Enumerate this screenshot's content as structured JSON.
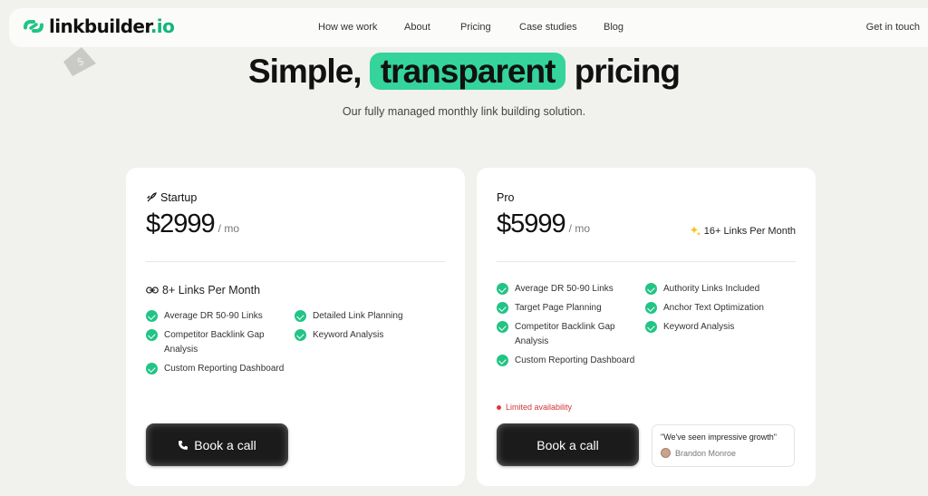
{
  "nav": {
    "brand_main": "linkbuilder",
    "brand_tld": ".io",
    "items": [
      {
        "label": "How we work"
      },
      {
        "label": "About"
      },
      {
        "label": "Pricing"
      },
      {
        "label": "Case studies"
      },
      {
        "label": "Blog"
      }
    ],
    "cta": "Get in touch"
  },
  "hero": {
    "title_before": "Simple,",
    "title_highlight": "transparent",
    "title_after": "pricing",
    "subtitle": "Our fully managed monthly link building solution.",
    "highlight_color": "#34d49c"
  },
  "plans": [
    {
      "name": "Startup",
      "name_icon": "rocket-icon",
      "price": "$2999",
      "period": "/ mo",
      "links": "8+ Links Per Month",
      "links_icon": "link-icon",
      "features_col1": [
        "Average DR 50-90 Links",
        "Competitor Backlink Gap Analysis",
        "Custom Reporting Dashboard"
      ],
      "features_col2": [
        "Detailed Link Planning",
        "Keyword Analysis"
      ],
      "cta": "Book a call",
      "cta_icon": "phone-icon"
    },
    {
      "name": "Pro",
      "price": "$5999",
      "period": "/ mo",
      "badge": "16+ Links Per Month",
      "badge_icon": "sparkles-icon",
      "features_col1": [
        "Average DR 50-90 Links",
        "Target Page Planning",
        "Competitor Backlink Gap Analysis",
        "Custom Reporting Dashboard"
      ],
      "features_col2": [
        "Authority Links Included",
        "Anchor Text Optimization",
        "Keyword Analysis"
      ],
      "availability": "Limited availability",
      "cta": "Book a call",
      "testimonial": {
        "quote": "\"We've seen impressive growth\"",
        "author": "Brandon Monroe"
      }
    }
  ],
  "colors": {
    "accent": "#22c486",
    "background": "#f1f1ee",
    "button": "#1b1b1b",
    "alert": "#d0373a"
  }
}
